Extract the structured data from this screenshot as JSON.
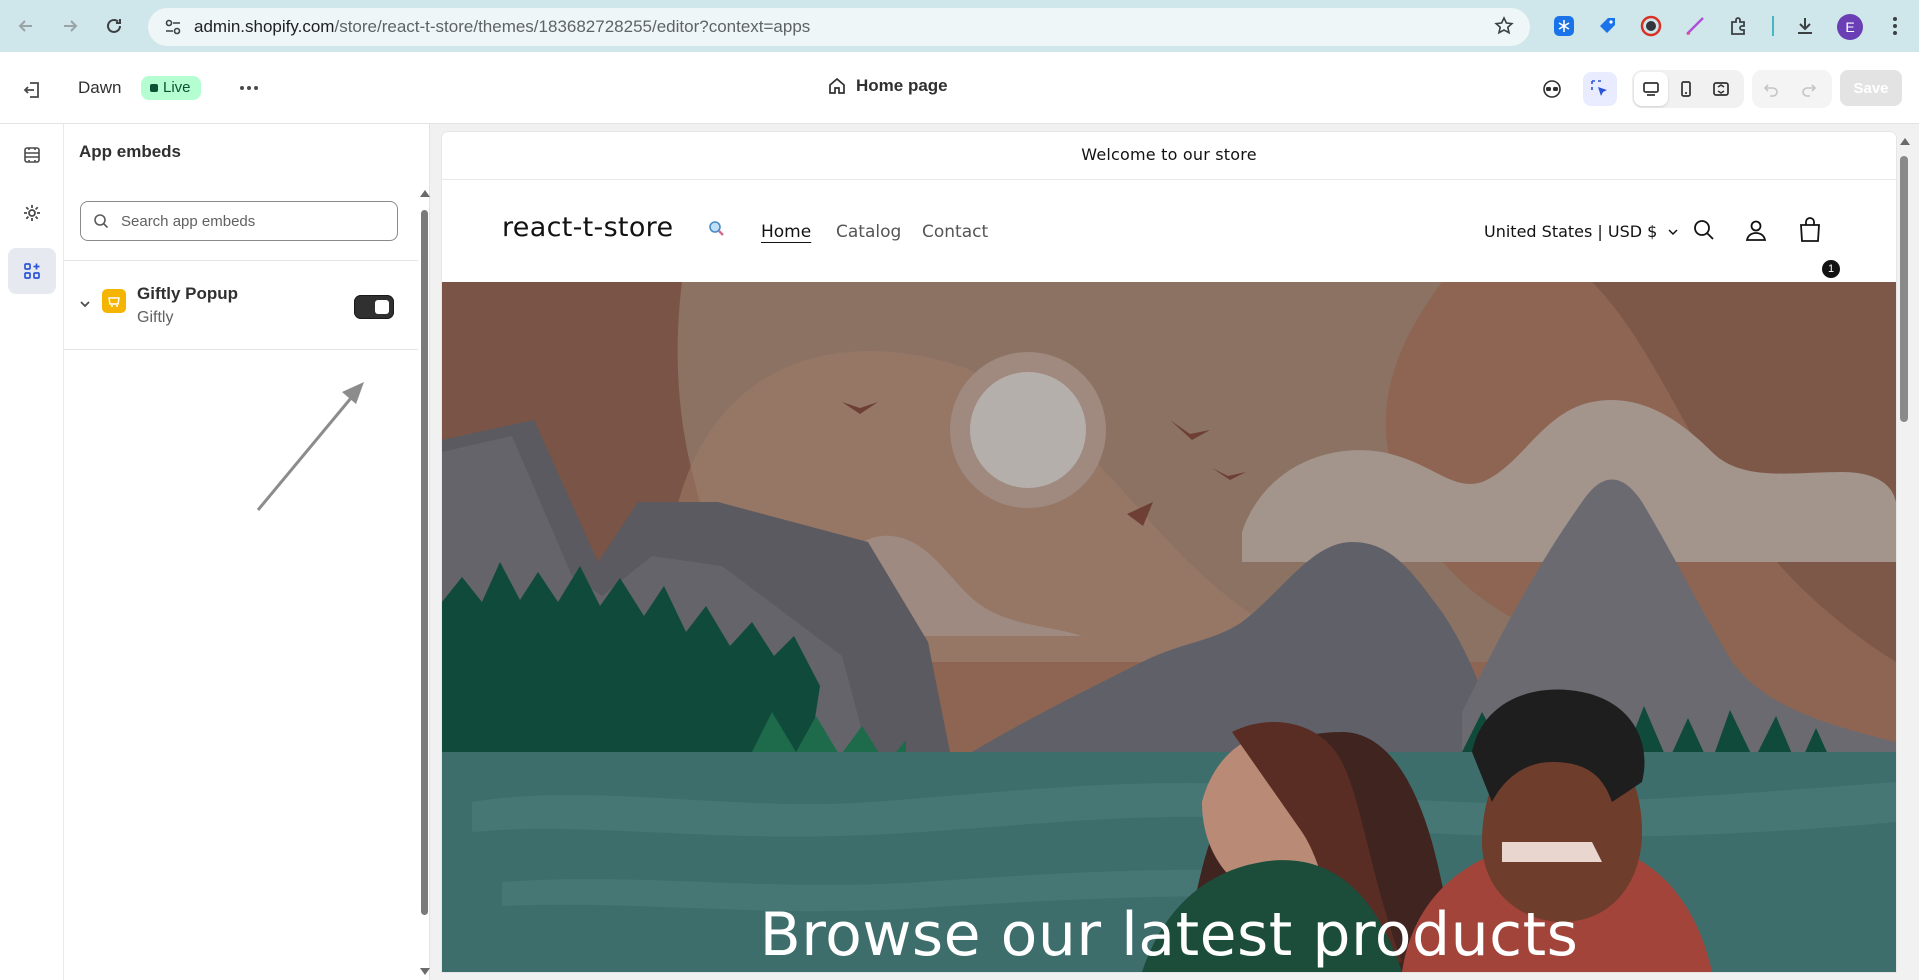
{
  "browser": {
    "url_host": "admin.shopify.com",
    "url_path": "/store/react-t-store/themes/183682728255/editor?context=apps",
    "profile_initial": "E"
  },
  "editor": {
    "theme_name": "Dawn",
    "live_label": "Live",
    "page_name": "Home page",
    "save_label": "Save"
  },
  "panel": {
    "title": "App embeds",
    "search_placeholder": "Search app embeds",
    "embeds": [
      {
        "name": "Giftly Popup",
        "vendor": "Giftly",
        "enabled": true
      }
    ]
  },
  "preview": {
    "announcement": "Welcome to our store",
    "store_name": "react-t-store",
    "nav": [
      "Home",
      "Catalog",
      "Contact"
    ],
    "country_currency": "United States | USD $",
    "cart_count": "1",
    "hero_heading": "Browse our latest products"
  },
  "icons": {
    "back": "arrow-left-icon",
    "forward": "arrow-right-icon",
    "reload": "reload-icon",
    "bookmark": "star-icon",
    "app_icon_color": "#f5b400",
    "live_color": "#b4fed2",
    "accent": "#2b55d9"
  }
}
